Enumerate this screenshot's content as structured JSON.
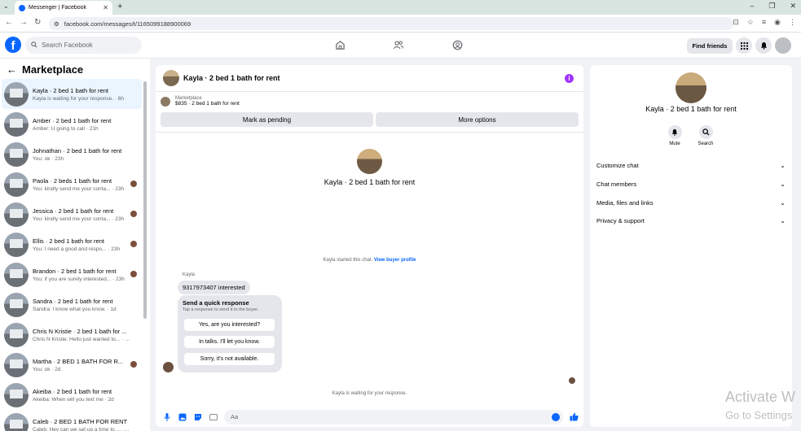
{
  "browser": {
    "tab_title": "Messenger | Facebook",
    "url": "facebook.com/messages/t/1165099188900069"
  },
  "header": {
    "search_placeholder": "Search Facebook",
    "find_friends": "Find friends"
  },
  "sidebar": {
    "title": "Marketplace",
    "conversations": [
      {
        "name": "Kayla · 2 bed 1 bath for rent",
        "preview": "Kayla is waiting for your response. · 6h",
        "active": true,
        "badge": false
      },
      {
        "name": "Amber · 2 bed 1 bath for rent",
        "preview": "Amber: U going to call · 21h",
        "active": false,
        "badge": false
      },
      {
        "name": "Johnathan · 2 bed 1 bath for rent",
        "preview": "You: ok · 23h",
        "active": false,
        "badge": false
      },
      {
        "name": "Paola · 2 beds 1 bath for rent",
        "preview": "You: kindly send me your conta... · 23h",
        "active": false,
        "badge": true
      },
      {
        "name": "Jessica · 2 bed 1 bath for rent",
        "preview": "You: kindly send me your conta... · 23h",
        "active": false,
        "badge": true
      },
      {
        "name": "Ellis · 2 bed 1 bath for rent",
        "preview": "You: I need a good and respo... · 23h",
        "active": false,
        "badge": true
      },
      {
        "name": "Brandon · 2 bed 1 bath for rent",
        "preview": "You: if you are surely interested... · 23h",
        "active": false,
        "badge": true
      },
      {
        "name": "Sandra · 2 bed 1 bath for rent",
        "preview": "Sandra: I know what you know. · 1d",
        "active": false,
        "badge": false
      },
      {
        "name": "Chris N Kristie · 2 bed 1 bath for ...",
        "preview": "Chris N Kristie: Hello just wanted to... · 1d",
        "active": false,
        "badge": false
      },
      {
        "name": "Martha · 2 BED 1 BATH FOR R...",
        "preview": "You: ok · 2d",
        "active": false,
        "badge": true
      },
      {
        "name": "Akeiba · 2 bed 1 bath for rent",
        "preview": "Akeiba: When will you text me · 2d",
        "active": false,
        "badge": false
      },
      {
        "name": "Caleb · 2 BED 1 BATH FOR RENT",
        "preview": "Caleb: Hey can we set up a time to ... · 3d",
        "active": false,
        "badge": false
      }
    ]
  },
  "chat": {
    "title": "Kayla · 2 bed 1 bath for rent",
    "listing_source": "Marketplace",
    "listing_price": "$835 · 2 bed 1 bath for rent",
    "mark_pending": "Mark as pending",
    "more_options": "More options",
    "center_name": "Kayla · 2 bed 1 bath for rent",
    "system_text": "Kayla started this chat.",
    "system_link": "View buyer profile",
    "sender_name": "Kayla",
    "message": "9317973407 interested",
    "quick_title": "Send a quick response",
    "quick_sub": "Tap a response to send it to the buyer.",
    "quick_replies": [
      "Yes, are you interested?",
      "In talks. I'll let you know.",
      "Sorry, it's not available."
    ],
    "waiting": "Kayla is waiting for your response.",
    "composer_placeholder": "Aa"
  },
  "details": {
    "name": "Kayla · 2 bed 1 bath for rent",
    "mute": "Mute",
    "search": "Search",
    "sections": [
      "Customize chat",
      "Chat members",
      "Media, files and links",
      "Privacy & support"
    ]
  },
  "watermark": {
    "line1": "Activate W",
    "line2": "Go to Settings"
  },
  "colors": {
    "brand": "#0866ff",
    "info_accent": "#a033ff"
  }
}
